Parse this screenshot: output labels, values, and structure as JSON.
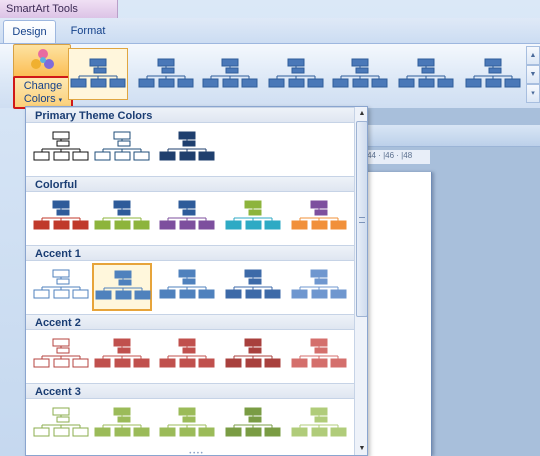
{
  "context_tab_group": "SmartArt Tools",
  "tabs": [
    {
      "label": "Design",
      "active": true
    },
    {
      "label": "Format",
      "active": false
    }
  ],
  "change_colors": {
    "line1": "Change",
    "line2": "Colors",
    "caret": "▾",
    "icon": "color-palette-icon"
  },
  "ribbon_gallery": {
    "style": "org-chart layout thumbnails",
    "count": 7,
    "selected_index": 0
  },
  "ruler": {
    "text": "|44 · |46 · |48"
  },
  "dropdown": {
    "sections": [
      {
        "title": "Primary Theme Colors",
        "variants": [
          {
            "stroke": "#111111",
            "fill": "#ffffff"
          },
          {
            "stroke": "#1f4e79",
            "fill": "#ffffff"
          },
          {
            "stroke": "#1f3f6e",
            "fill": "#1f3f6e"
          }
        ]
      },
      {
        "title": "Colorful",
        "variants": [
          {
            "top": "#2e5b9a",
            "bottom": "#c0392b"
          },
          {
            "top": "#2e5b9a",
            "bottom": "#8db43c"
          },
          {
            "top": "#2e5b9a",
            "bottom": "#7d4f9e"
          },
          {
            "top": "#8db43c",
            "bottom": "#2eaac4"
          },
          {
            "top": "#7d4f9e",
            "bottom": "#f1903a"
          }
        ]
      },
      {
        "title": "Accent 1",
        "selected_index": 1,
        "variants": [
          {
            "stroke": "#4f81bd",
            "fill": "#ffffff"
          },
          {
            "stroke": "#4f81bd",
            "fill": "#4f81bd"
          },
          {
            "stroke": "#4f81bd",
            "fill": "#4f81bd"
          },
          {
            "stroke": "#3d6aa8",
            "fill": "#3d6aa8"
          },
          {
            "stroke": "#6f97cf",
            "fill": "#6f97cf"
          }
        ]
      },
      {
        "title": "Accent 2",
        "variants": [
          {
            "stroke": "#b4433f",
            "fill": "#ffffff"
          },
          {
            "stroke": "#c0504d",
            "fill": "#c0504d"
          },
          {
            "stroke": "#c0504d",
            "fill": "#c0504d"
          },
          {
            "stroke": "#a8403d",
            "fill": "#a8403d"
          },
          {
            "stroke": "#d46f6c",
            "fill": "#d46f6c"
          }
        ]
      },
      {
        "title": "Accent 3",
        "variants": [
          {
            "stroke": "#8bad4d",
            "fill": "#ffffff"
          },
          {
            "stroke": "#9bbb59",
            "fill": "#9bbb59"
          },
          {
            "stroke": "#9bbb59",
            "fill": "#9bbb59"
          },
          {
            "stroke": "#7a9c44",
            "fill": "#7a9c44"
          },
          {
            "stroke": "#b0cc7a",
            "fill": "#b0cc7a"
          }
        ]
      }
    ]
  },
  "colors": {
    "accent_highlight": "#d01818",
    "selection_border": "#e7a43a"
  }
}
